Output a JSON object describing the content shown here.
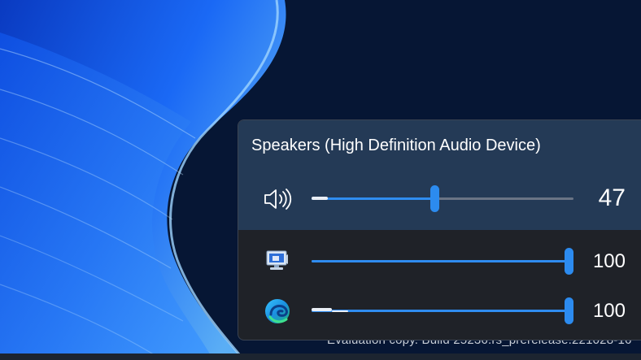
{
  "colors": {
    "accent": "#2f8cf0",
    "panel": "#1f2228",
    "device_panel": "#243a56",
    "desktop": "#061634"
  },
  "watermark": {
    "text": "Evaluation copy. Build 25236.rs_prerelease.221028-16"
  },
  "device": {
    "name": "Speakers (High Definition Audio Device)",
    "icon": "speaker-icon",
    "volume": 47,
    "volume_label": "47"
  },
  "apps": [
    {
      "icon": "system-sounds-icon",
      "volume": 100,
      "volume_label": "100"
    },
    {
      "icon": "edge-icon",
      "volume": 100,
      "volume_label": "100"
    }
  ]
}
